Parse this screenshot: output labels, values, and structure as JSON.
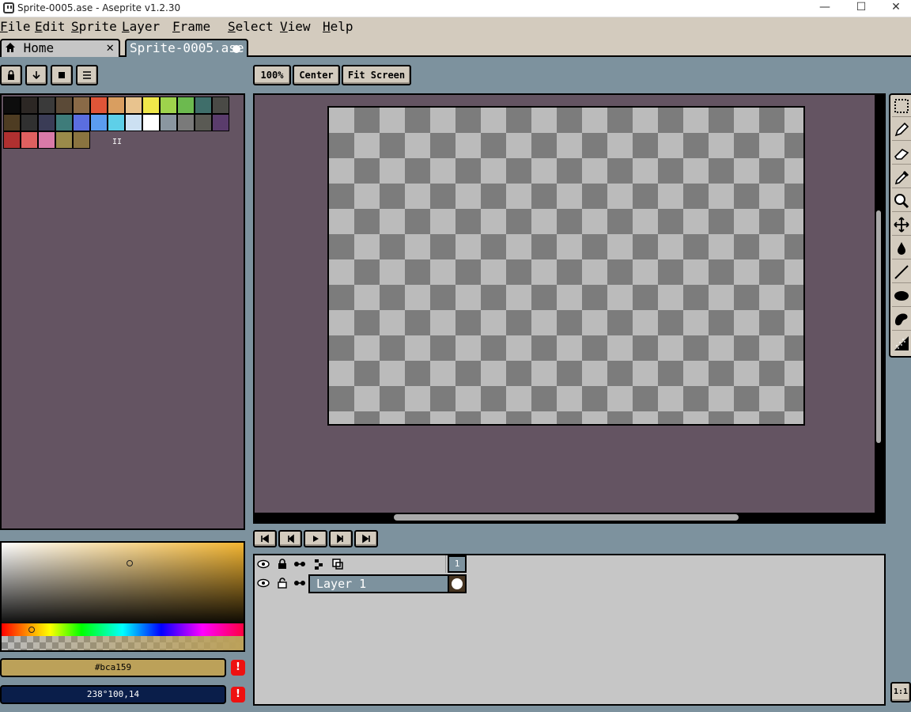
{
  "window": {
    "title": "Sprite-0005.ase - Aseprite v1.2.30",
    "controls": [
      "—",
      "☐",
      "✕"
    ]
  },
  "menu": [
    "File",
    "Edit",
    "Sprite",
    "Layer",
    "Frame",
    "Select",
    "View",
    "Help"
  ],
  "tabs": {
    "home": {
      "label": "Home",
      "close": "✕"
    },
    "sprite": {
      "label": "Sprite-0005.ase"
    }
  },
  "palette_toolbar": {
    "buttons": [
      "lock-icon",
      "down-arrow-icon",
      "square-icon",
      "menu-icon"
    ]
  },
  "zoom_buttons": {
    "zoom": "100%",
    "center": "Center",
    "fit": "Fit Screen"
  },
  "palette": {
    "colors": [
      "#0d0d0d",
      "#2c2724",
      "#3a3a3a",
      "#5b4a37",
      "#8a6a47",
      "#e05538",
      "#d99e60",
      "#e8c38e",
      "#f0e84a",
      "#9ed34c",
      "#6cba4f",
      "#3f6e6a",
      "#4a4a46",
      "#4e3c22",
      "#303030",
      "#3a3c56",
      "#3e7c7a",
      "#5b6ee0",
      "#5b9cf0",
      "#5ecfe8",
      "#cce0f2",
      "#ffffff",
      "#8a96a0",
      "#7a7a7a",
      "#5a5a54",
      "#5a3c6c",
      "#b03030",
      "#e06060",
      "#d97aa8",
      "#9a8a4a",
      "#8a7440"
    ],
    "overflow_label": "II"
  },
  "color_fields": {
    "foreground": {
      "value": "#bca159",
      "color": "#bca159",
      "text_color": "#000000"
    },
    "background": {
      "value": "238°100,14",
      "color": "#0a1e4a",
      "text_color": "#ffffff"
    },
    "warning": "!"
  },
  "tools": [
    "marquee-icon",
    "pencil-icon",
    "eraser-icon",
    "eyedropper-icon",
    "zoom-icon",
    "move-icon",
    "bucket-icon",
    "line-icon",
    "ellipse-icon",
    "contour-icon",
    "spray-icon"
  ],
  "playback": [
    "first-frame-icon",
    "prev-frame-icon",
    "play-icon",
    "next-frame-icon",
    "last-frame-icon"
  ],
  "timeline": {
    "frame_number": "1",
    "layer_name": "Layer 1"
  },
  "bottom_button": "1:1"
}
